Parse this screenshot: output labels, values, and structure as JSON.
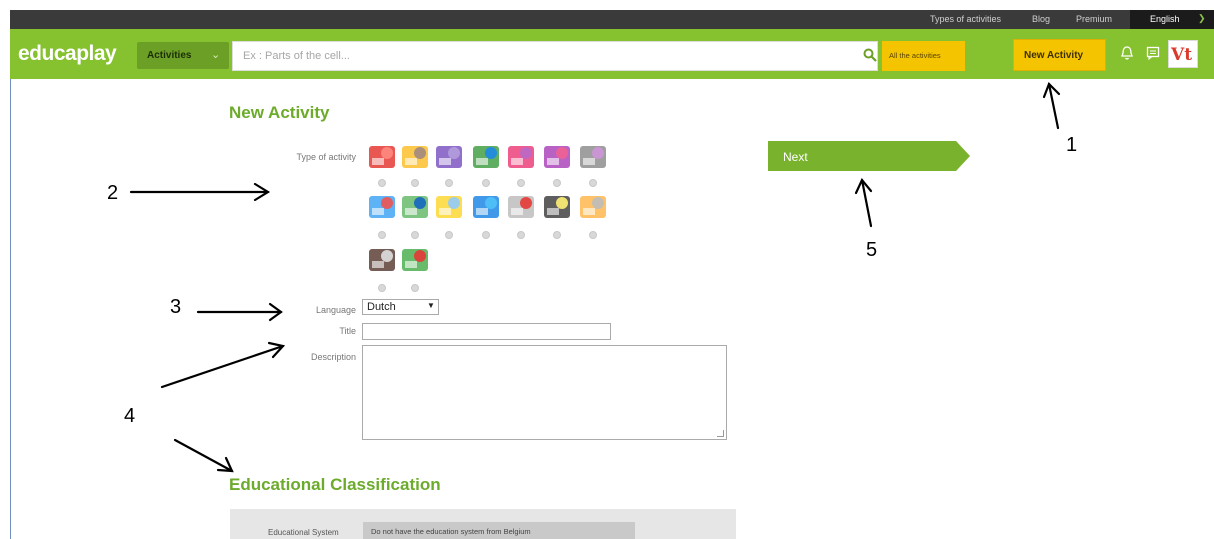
{
  "topbar": {
    "links": [
      "Types of activities",
      "Blog",
      "Premium"
    ],
    "language": "English"
  },
  "header": {
    "logo": "educaplay",
    "activities_label": "Activities",
    "search_placeholder": "Ex : Parts of the cell...",
    "all_activities_label": "All the activities",
    "new_activity_label": "New Activity",
    "avatar_text": "Vt"
  },
  "form": {
    "heading": "New Activity",
    "type_label": "Type of activity",
    "language_label": "Language",
    "language_value": "Dutch",
    "title_label": "Title",
    "title_value": "",
    "description_label": "Description",
    "description_value": ""
  },
  "next_label": "Next",
  "classification": {
    "heading": "Educational Classification",
    "system_label": "Educational System",
    "system_value": "Do not have the education system from Belgium"
  },
  "annotations": [
    "1",
    "2",
    "3",
    "4",
    "5"
  ],
  "activity_icons": [
    "quiz-icon",
    "crossword-icon",
    "word-search-icon",
    "puzzle-icon",
    "writing-icon",
    "matching-icon",
    "film-strip-icon",
    "diagram-icon",
    "columns-icon",
    "relate-icon",
    "map-icon",
    "chart-icon",
    "video-icon",
    "slides-icon",
    "photo-icon",
    "riddle-icon"
  ],
  "colors": {
    "green": "#86c12f",
    "yellow": "#f5c400",
    "heading_green": "#6cab2b"
  }
}
